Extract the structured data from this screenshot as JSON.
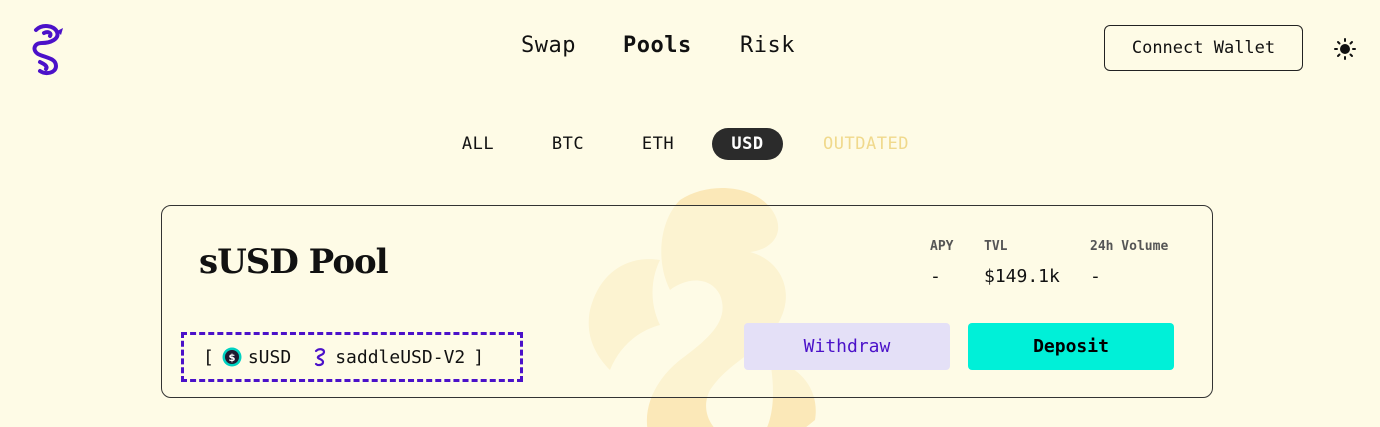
{
  "header": {
    "logo_icon": "saddle-seahorse-logo",
    "nav": [
      {
        "label": "Swap",
        "active": false
      },
      {
        "label": "Pools",
        "active": true
      },
      {
        "label": "Risk",
        "active": false
      }
    ],
    "connect_wallet": "Connect Wallet",
    "theme_icon": "sun-icon"
  },
  "filters": [
    {
      "label": "ALL",
      "active": false
    },
    {
      "label": "BTC",
      "active": false
    },
    {
      "label": "ETH",
      "active": false
    },
    {
      "label": "USD",
      "active": true
    },
    {
      "label": "OUTDATED",
      "active": false
    }
  ],
  "pool": {
    "title": "sUSD Pool",
    "stats": {
      "apy_label": "APY",
      "apy_value": "-",
      "tvl_label": "TVL",
      "tvl_value": "$149.1k",
      "volume_label": "24h Volume",
      "volume_value": "-"
    },
    "tokens_open": "[",
    "tokens": [
      {
        "symbol": "sUSD",
        "icon": "susd-token-icon"
      },
      {
        "symbol": "saddleUSD-V2",
        "icon": "saddle-lp-token-icon"
      }
    ],
    "tokens_close": "]",
    "withdraw_label": "Withdraw",
    "deposit_label": "Deposit"
  },
  "colors": {
    "background": "#fefbe6",
    "accent_purple": "#4b11c9",
    "deposit_teal": "#00f0d8",
    "withdraw_bg": "#e4e0f7",
    "outdated_text": "#f0d98c"
  }
}
